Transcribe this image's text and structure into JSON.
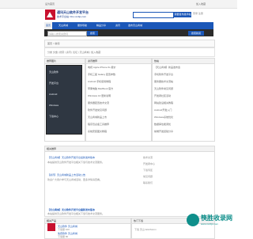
{
  "topbar": {
    "left_text": "设为首页",
    "right_text": "加入收藏"
  },
  "header": {
    "site_name": "通讯天山软件开发平台",
    "site_url": "技术平台站: bbs.xxxbjs.com",
    "search_button": "我要发布技术帖",
    "right_links": "登录  注册"
  },
  "nav": {
    "items": [
      {
        "label": "首页"
      },
      {
        "label": "天山商城"
      },
      {
        "label": "服务导航"
      },
      {
        "label": "精品分享"
      },
      {
        "label": "资讯"
      },
      {
        "label": "发布天山商城"
      }
    ]
  },
  "subbar": {
    "search_placeholder": "请输入搜索关键词",
    "search_button": "搜索",
    "right_button": "搜索新闻"
  },
  "breadcrumb": {
    "text": "首页 > 新闻"
  },
  "tags_text": "分类 文章 | 搜索 | 资讯 | 论坛 | 天山商城 | 加入收藏",
  "panels": {
    "left": {
      "title": "推荐图片"
    },
    "middle": {
      "title": "资讯推荐"
    },
    "right": {
      "title": "热帖"
    }
  },
  "dark_image_text": [
    "天山软件",
    "开发平台",
    "Android",
    "Windows",
    "下载中心"
  ],
  "middle_list": [
    "电视 Apple iPhone 6s 报价",
    "手机三星 Galaxy 配置参数",
    "Android 手机使用教程",
    "苹果电脑 MacBook 官方",
    "Windows 10 更新说明",
    "服务器配置技术交流",
    "软件开发常见问题",
    "天山商城新品上市",
    "程序员必备工具推荐",
    "系统安装图文教程"
  ],
  "right_list": [
    "【天山商城】新品发布会",
    "手机软件开发平台",
    "服务器技术交流帖",
    "天山软件常见问题",
    "开发者社区活动",
    "网站建设相关教程",
    "Android开发入门",
    "Windows系统优化",
    "数据库性能调优",
    "前端开发经验分享"
  ],
  "related": {
    "title": "相关推荐",
    "item1_title": "【天山商城】天山软件开发平台最新发布版本",
    "item1_desc": "本站提供天山软件开发平台相关下载与技术交流服务。",
    "item2_title": "【资讯】天山商城新品上市活动公告",
    "item2_desc": "欢迎广大用户参与天山商城活动，更多详情请查看。",
    "side_links": [
      "技术交流",
      "开发者中心",
      "下载专区",
      "常见问题",
      "联系我们"
    ]
  },
  "bottom": {
    "left_title": "相关产品",
    "item1": "天山软件 天山商城",
    "item1_meta": "下载量 100",
    "item2": "免费软件 天山商城",
    "item2_meta": "下载量 80",
    "right_title": "热门下载",
    "right_item": "下载 天山 WebStorm"
  },
  "watermark": {
    "main": "筷胜收录网",
    "sub": "www.xxxbjs.com"
  },
  "colors": {
    "brand_blue": "#1b57b8",
    "logo_red": "#c8102e",
    "dark": "#2b2b2b",
    "watermark": "#0f8f8b"
  }
}
